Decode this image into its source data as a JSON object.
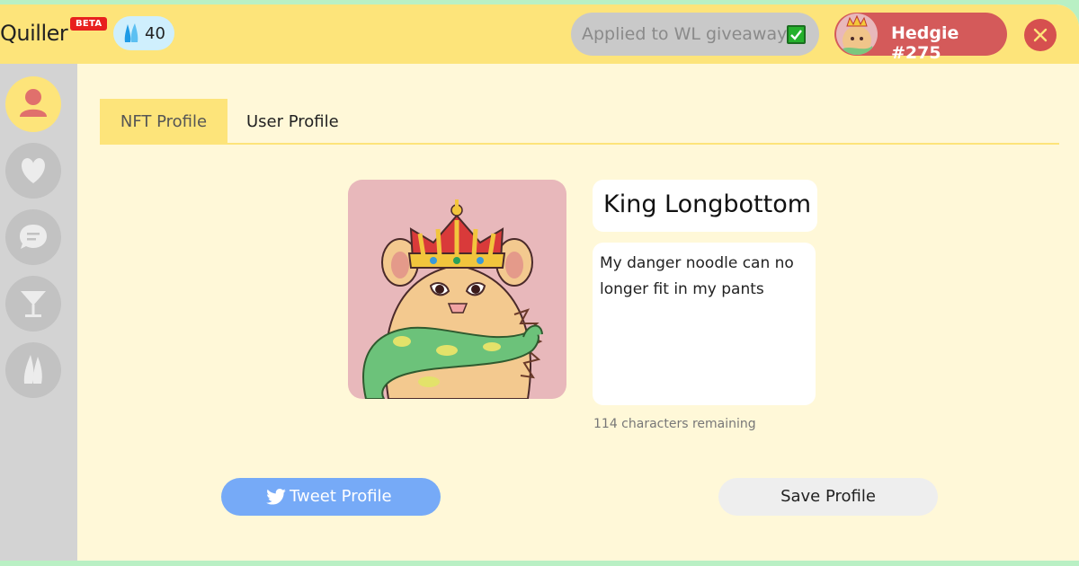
{
  "header": {
    "brand": "Quiller",
    "badge": "BETA",
    "drops_icon": "drops-icon",
    "drops_count": "40",
    "whitelist_status": "Applied to WL giveaway",
    "whitelist_check_icon": "checkmark-icon",
    "user_name": "Hedgie #275",
    "close_icon": "close-icon"
  },
  "sidebar": {
    "items": [
      {
        "icon": "profile-icon",
        "active": true
      },
      {
        "icon": "heart-icon",
        "active": false
      },
      {
        "icon": "chat-icon",
        "active": false
      },
      {
        "icon": "cocktail-icon",
        "active": false
      },
      {
        "icon": "drops-icon",
        "active": false
      }
    ]
  },
  "tabs": [
    {
      "label": "NFT Profile",
      "active": true
    },
    {
      "label": "User Profile",
      "active": false
    }
  ],
  "profile": {
    "name": "King Longbottom",
    "bio": "My danger noodle can no longer fit in my pants",
    "remaining": "114 characters remaining"
  },
  "actions": {
    "tweet_label": "Tweet Profile",
    "tweet_icon": "twitter-icon",
    "save_label": "Save Profile"
  },
  "colors": {
    "accent_yellow": "#fde47a",
    "user_red": "#d45a5a",
    "tweet_blue": "#76aaf7",
    "background": "#fff8d8"
  }
}
